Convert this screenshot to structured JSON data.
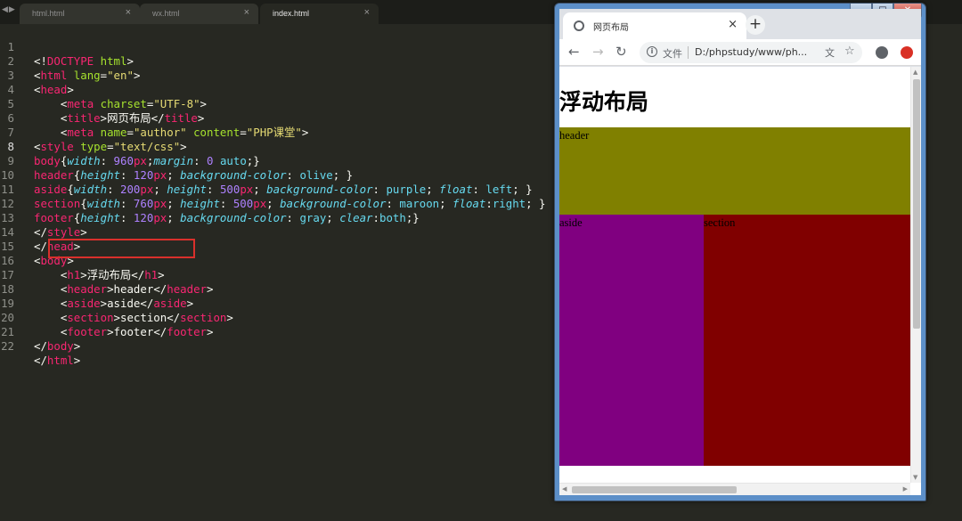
{
  "editor": {
    "tabs": [
      {
        "label": "html.html"
      },
      {
        "label": "wx.html"
      },
      {
        "label": "index.html"
      }
    ],
    "lines": [
      {
        "n": "1"
      },
      {
        "n": "2"
      },
      {
        "n": "3"
      },
      {
        "n": "4"
      },
      {
        "n": "5"
      },
      {
        "n": "6"
      },
      {
        "n": "7"
      },
      {
        "n": "8"
      },
      {
        "n": "9"
      },
      {
        "n": "10"
      },
      {
        "n": "11"
      },
      {
        "n": "12"
      },
      {
        "n": "13"
      },
      {
        "n": "14"
      },
      {
        "n": "15"
      },
      {
        "n": "16"
      },
      {
        "n": "17"
      },
      {
        "n": "18"
      },
      {
        "n": "19"
      },
      {
        "n": "20"
      },
      {
        "n": "21"
      },
      {
        "n": "22"
      }
    ],
    "code": {
      "doctype_kw": "DOCTYPE",
      "doctype_val": "html",
      "html_tag": "html",
      "lang_attr": "lang",
      "lang_val": "\"en\"",
      "head_tag": "head",
      "meta_tag": "meta",
      "charset_attr": "charset",
      "charset_val": "\"UTF-8\"",
      "title_tag": "title",
      "title_text": "网页布局",
      "name_attr": "name",
      "name_val": "\"author\"",
      "content_attr": "content",
      "content_val": "\"PHP课堂\"",
      "style_tag": "style",
      "type_attr": "type",
      "type_val": "\"text/css\"",
      "body_sel": "body",
      "header_sel": "header",
      "aside_sel": "aside",
      "section_sel": "section",
      "footer_sel": "footer",
      "p_width": "width",
      "p_margin": "margin",
      "p_height": "height",
      "p_bg": "background-color",
      "p_float": "float",
      "p_clear": "clear",
      "v960": "960",
      "v0": "0",
      "v120": "120",
      "v200": "200",
      "v500": "500",
      "v760": "760",
      "unit_px": "px",
      "v_auto": "auto",
      "v_olive": "olive",
      "v_purple": "purple",
      "v_maroon": "maroon",
      "v_gray": "gray",
      "v_left": "left",
      "v_right": "right",
      "v_both": "both",
      "body_tag": "body",
      "h1_tag": "h1",
      "h1_text": "浮动布局",
      "header_tag": "header",
      "header_text": "header",
      "aside_tag": "aside",
      "aside_text": "aside",
      "section_tag": "section",
      "section_text": "section",
      "footer_tag": "footer",
      "footer_text": "footer"
    }
  },
  "browser": {
    "tab_title": "网页布局",
    "file_label": "文件",
    "url": "D:/phpstudy/www/ph...",
    "page": {
      "h1": "浮动布局",
      "header": "header",
      "aside": "aside",
      "section": "section"
    },
    "colors": {
      "header": "#808000",
      "aside": "#800080",
      "section": "#800000"
    }
  }
}
